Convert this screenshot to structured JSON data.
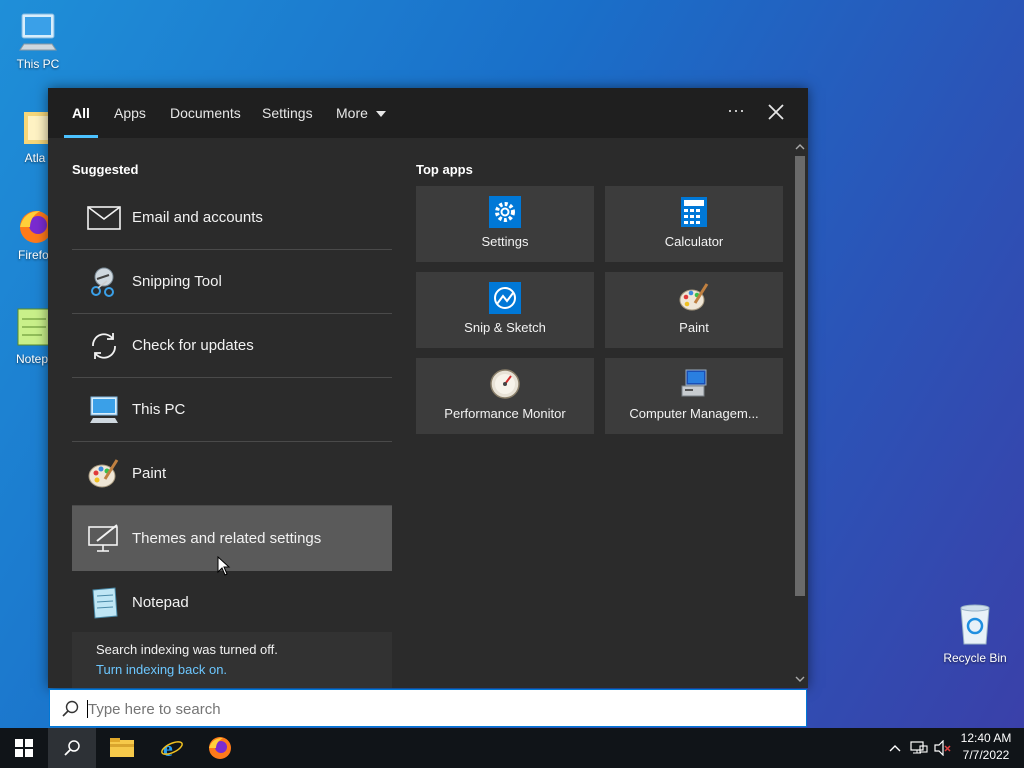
{
  "desktop": {
    "icons": [
      {
        "label": "This PC"
      },
      {
        "label": "Atla"
      },
      {
        "label": "Firefo"
      },
      {
        "label": "Notepa"
      },
      {
        "label": "Recycle Bin"
      }
    ]
  },
  "search": {
    "tabs": [
      "All",
      "Apps",
      "Documents",
      "Settings",
      "More"
    ],
    "active_tab": "All",
    "suggested_heading": "Suggested",
    "suggested": [
      {
        "label": "Email and accounts",
        "icon": "mail-icon"
      },
      {
        "label": "Snipping Tool",
        "icon": "snipping-tool-icon"
      },
      {
        "label": "Check for updates",
        "icon": "refresh-icon"
      },
      {
        "label": "This PC",
        "icon": "this-pc-icon"
      },
      {
        "label": "Paint",
        "icon": "paint-icon"
      },
      {
        "label": "Themes and related settings",
        "icon": "themes-icon"
      },
      {
        "label": "Notepad",
        "icon": "notepad-icon"
      }
    ],
    "top_apps_heading": "Top apps",
    "top_apps": [
      {
        "label": "Settings",
        "icon": "gear-icon"
      },
      {
        "label": "Calculator",
        "icon": "calculator-icon"
      },
      {
        "label": "Snip & Sketch",
        "icon": "snip-sketch-icon"
      },
      {
        "label": "Paint",
        "icon": "paint-icon"
      },
      {
        "label": "Performance Monitor",
        "icon": "performance-monitor-icon"
      },
      {
        "label": "Computer Managem...",
        "icon": "computer-management-icon"
      }
    ],
    "notice_text": "Search indexing was turned off.",
    "notice_link": "Turn indexing back on.",
    "placeholder": "Type here to search"
  },
  "taskbar": {
    "time": "12:40 AM",
    "date": "7/7/2022"
  },
  "colors": {
    "accent": "#4cc2ff",
    "link": "#6cc7ff",
    "panel": "#2b2b2b"
  }
}
